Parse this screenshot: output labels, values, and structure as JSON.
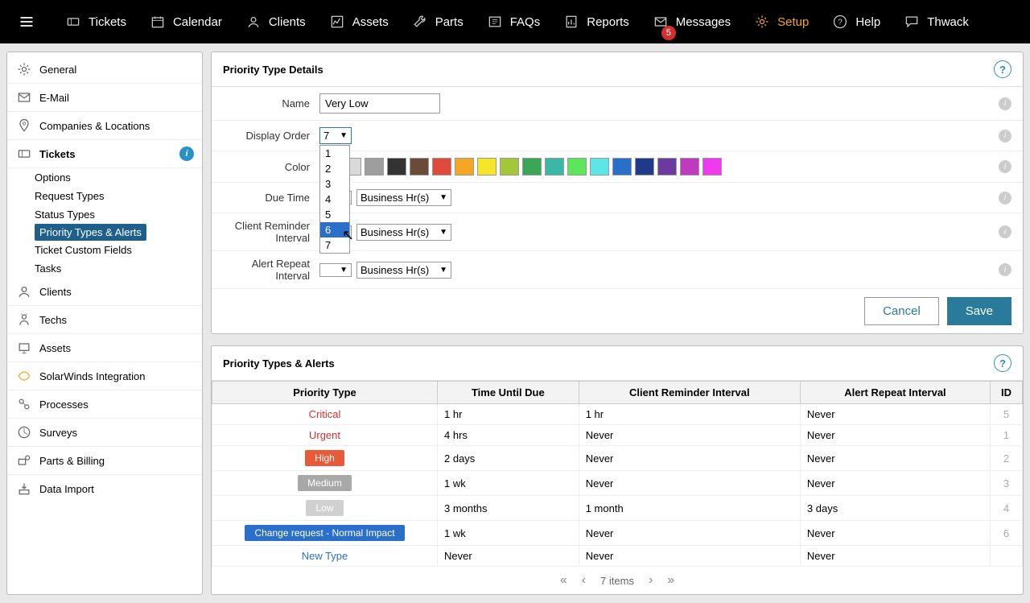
{
  "topnav": {
    "items": [
      {
        "label": "Tickets",
        "icon": "ticket"
      },
      {
        "label": "Calendar",
        "icon": "calendar"
      },
      {
        "label": "Clients",
        "icon": "user"
      },
      {
        "label": "Assets",
        "icon": "chart"
      },
      {
        "label": "Parts",
        "icon": "wrench"
      },
      {
        "label": "FAQs",
        "icon": "faq"
      },
      {
        "label": "Reports",
        "icon": "report"
      },
      {
        "label": "Messages",
        "icon": "mail",
        "badge": "5"
      },
      {
        "label": "Setup",
        "icon": "gear",
        "active": true
      },
      {
        "label": "Help",
        "icon": "help"
      },
      {
        "label": "Thwack",
        "icon": "chat"
      }
    ]
  },
  "sidebar": {
    "groups1": [
      {
        "label": "General",
        "icon": "gear"
      },
      {
        "label": "E-Mail",
        "icon": "mail"
      },
      {
        "label": "Companies & Locations",
        "icon": "pin"
      },
      {
        "label": "Tickets",
        "icon": "ticket",
        "selected": true,
        "info": true
      }
    ],
    "sub": [
      {
        "label": "Options"
      },
      {
        "label": "Request Types"
      },
      {
        "label": "Status Types"
      },
      {
        "label": "Priority Types & Alerts",
        "active": true
      },
      {
        "label": "Ticket Custom Fields"
      },
      {
        "label": "Tasks"
      }
    ],
    "groups2": [
      {
        "label": "Clients",
        "icon": "user"
      },
      {
        "label": "Techs",
        "icon": "tech"
      },
      {
        "label": "Assets",
        "icon": "asset"
      },
      {
        "label": "SolarWinds Integration",
        "icon": "sw"
      },
      {
        "label": "Processes",
        "icon": "proc"
      },
      {
        "label": "Surveys",
        "icon": "survey"
      },
      {
        "label": "Parts & Billing",
        "icon": "parts"
      },
      {
        "label": "Data Import",
        "icon": "import"
      }
    ]
  },
  "details": {
    "title": "Priority Type Details",
    "labels": {
      "name": "Name",
      "display_order": "Display Order",
      "color": "Color",
      "due_time": "Due Time",
      "client_reminder": "Client Reminder Interval",
      "alert_repeat": "Alert Repeat Interval"
    },
    "name_value": "Very Low",
    "display_order_value": "7",
    "display_order_options": [
      "1",
      "2",
      "3",
      "4",
      "5",
      "6",
      "7"
    ],
    "display_order_hover": "6",
    "unit_label": "Business Hr(s)",
    "colors": [
      "#ffffff",
      "#d9d9d9",
      "#9e9e9e",
      "#333333",
      "#6b4a3a",
      "#e04a3a",
      "#f5a623",
      "#f5e62a",
      "#a4c639",
      "#3aa757",
      "#3ab7a7",
      "#5ce65c",
      "#5ce6e6",
      "#2a6fc9",
      "#1f3a8b",
      "#6b3a9e",
      "#c03ac0",
      "#f03af0"
    ],
    "cancel": "Cancel",
    "save": "Save"
  },
  "table": {
    "title": "Priority Types & Alerts",
    "headers": [
      "Priority Type",
      "Time Until Due",
      "Client Reminder Interval",
      "Alert Repeat Interval",
      "ID"
    ],
    "rows": [
      {
        "ptype": "Critical",
        "style": "link",
        "color": "#d03030",
        "due": "1 hr",
        "cri": "1 hr",
        "ari": "Never",
        "id": "5"
      },
      {
        "ptype": "Urgent",
        "style": "link",
        "color": "#d03030",
        "due": "4 hrs",
        "cri": "Never",
        "ari": "Never",
        "id": "1"
      },
      {
        "ptype": "High",
        "style": "badge",
        "color": "#e85a3a",
        "due": "2 days",
        "cri": "Never",
        "ari": "Never",
        "id": "2"
      },
      {
        "ptype": "Medium",
        "style": "badge",
        "color": "#a8a8a8",
        "due": "1 wk",
        "cri": "Never",
        "ari": "Never",
        "id": "3"
      },
      {
        "ptype": "Low",
        "style": "badge",
        "color": "#d0d0d0",
        "due": "3 months",
        "cri": "1 month",
        "ari": "3 days",
        "id": "4"
      },
      {
        "ptype": "Change request - Normal Impact",
        "style": "badge",
        "color": "#2a6fc9",
        "due": "1 wk",
        "cri": "Never",
        "ari": "Never",
        "id": "6"
      },
      {
        "ptype": "New Type",
        "style": "link",
        "color": "#2a6fc9",
        "due": "Never",
        "cri": "Never",
        "ari": "Never",
        "id": ""
      }
    ],
    "pager": "7 items"
  }
}
